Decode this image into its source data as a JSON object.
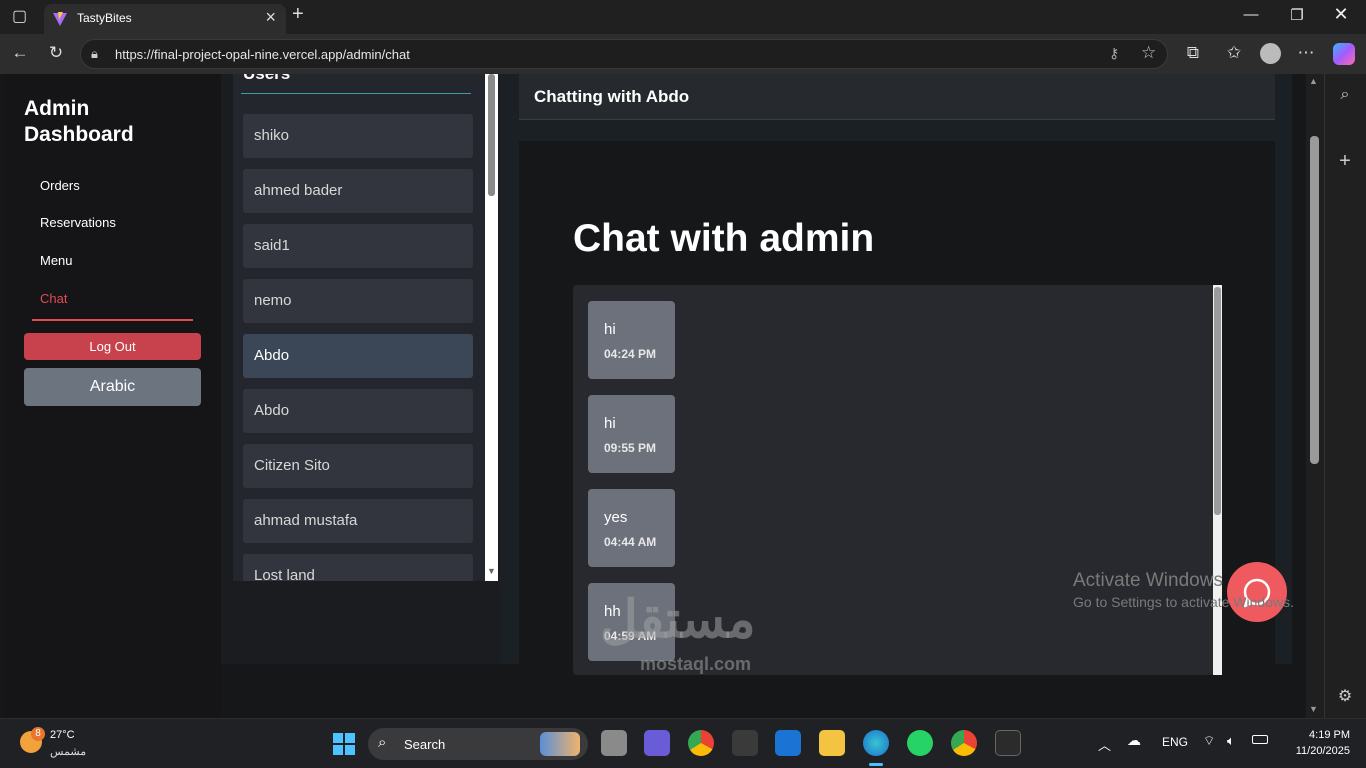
{
  "browser": {
    "tab_title": "TastyBites",
    "url": "https://final-project-opal-nine.vercel.app/admin/chat"
  },
  "admin": {
    "title": "Admin Dashboard",
    "nav": [
      {
        "label": "Orders"
      },
      {
        "label": "Reservations"
      },
      {
        "label": "Menu"
      },
      {
        "label": "Chat",
        "active": true
      }
    ],
    "logout_label": "Log Out",
    "language_label": "Arabic"
  },
  "users": {
    "heading": "Users",
    "list": [
      {
        "name": "shiko"
      },
      {
        "name": "ahmed bader"
      },
      {
        "name": "said1"
      },
      {
        "name": "nemo"
      },
      {
        "name": "Abdo",
        "active": true
      },
      {
        "name": "Abdo"
      },
      {
        "name": "Citizen Sito"
      },
      {
        "name": "ahmad mustafa"
      },
      {
        "name": "Lost land"
      }
    ]
  },
  "chat": {
    "header": "Chatting with Abdo",
    "heading": "Chat with admin",
    "messages": [
      {
        "text": "hi",
        "time": "04:24 PM"
      },
      {
        "text": "hi",
        "time": "09:55 PM"
      },
      {
        "text": "yes",
        "time": "04:44 AM"
      },
      {
        "text": "hh",
        "time": "04:59 AM"
      }
    ]
  },
  "watermark": {
    "activate_line1": "Activate Windows",
    "activate_line2": "Go to Settings to activate Windows.",
    "mostaql": "مستقل",
    "mostaql_sub": "mostaql.com"
  },
  "taskbar": {
    "weather_badge": "8",
    "temperature": "27°C",
    "weather_desc": "مشمس",
    "search_label": "Search",
    "language": "ENG",
    "time": "4:19 PM",
    "date": "11/20/2025"
  },
  "colors": {
    "accent_red": "#e24a55",
    "fab": "#ef5a5f",
    "logout_bg": "#c7424c",
    "windows_blue": "#4cc2ff"
  }
}
